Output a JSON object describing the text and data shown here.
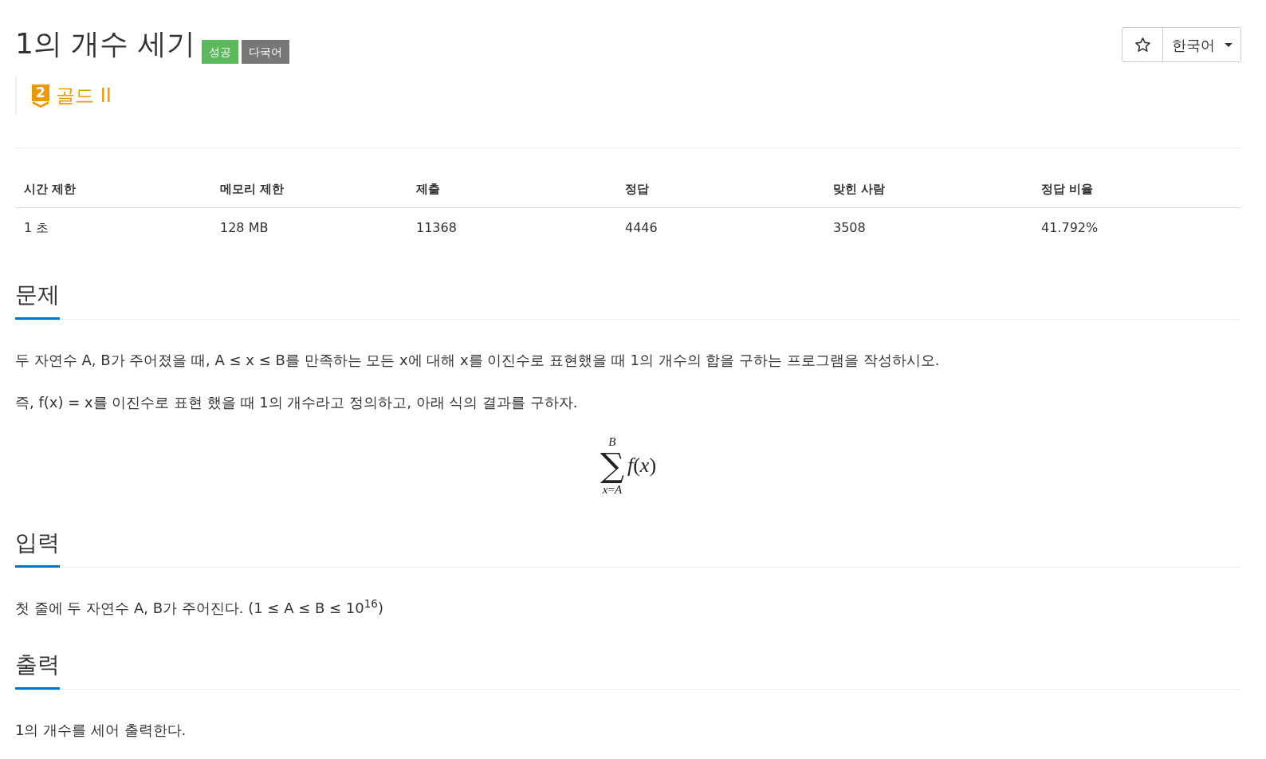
{
  "problem": {
    "title": "1의 개수 세기",
    "labels": [
      {
        "text": "성공",
        "kind": "success"
      },
      {
        "text": "다국어",
        "kind": "multilang"
      }
    ]
  },
  "tier": {
    "level": "2",
    "name": "골드 II"
  },
  "actions": {
    "star": {
      "on": false
    },
    "language": "한국어"
  },
  "stats": {
    "columns": [
      "시간 제한",
      "메모리 제한",
      "제출",
      "정답",
      "맞힌 사람",
      "정답 비율"
    ],
    "rows": [
      [
        "1 초",
        "128 MB",
        "11368",
        "4446",
        "3508",
        "41.792%"
      ]
    ]
  },
  "sections": [
    {
      "title": "문제",
      "blocks": [
        {
          "kind": "text",
          "text": "두 자연수 A, B가 주어졌을 때, A ≤ x ≤ B를 만족하는 모든 x에 대해 x를 이진수로 표현했을 때 1의 개수의 합을 구하는 프로그램을 작성하시오."
        },
        {
          "kind": "text",
          "text": "즉, f(x) = x를 이진수로 표현 했을 때 1의 개수라고 정의하고, 아래 식의 결과를 구하자."
        },
        {
          "kind": "formula",
          "upper": "B",
          "operator": "∑",
          "lower": "*x*=*A*",
          "body": "*f*(*x*)"
        }
      ]
    },
    {
      "title": "입력",
      "blocks": [
        {
          "kind": "text",
          "text": "첫 줄에 두 자연수 A, B가 주어진다. (1 ≤ A ≤ B ≤ 10$^{16}$)"
        }
      ]
    },
    {
      "title": "출력",
      "blocks": [
        {
          "kind": "text",
          "text": "1의 개수를 세어 출력한다."
        }
      ]
    }
  ]
}
